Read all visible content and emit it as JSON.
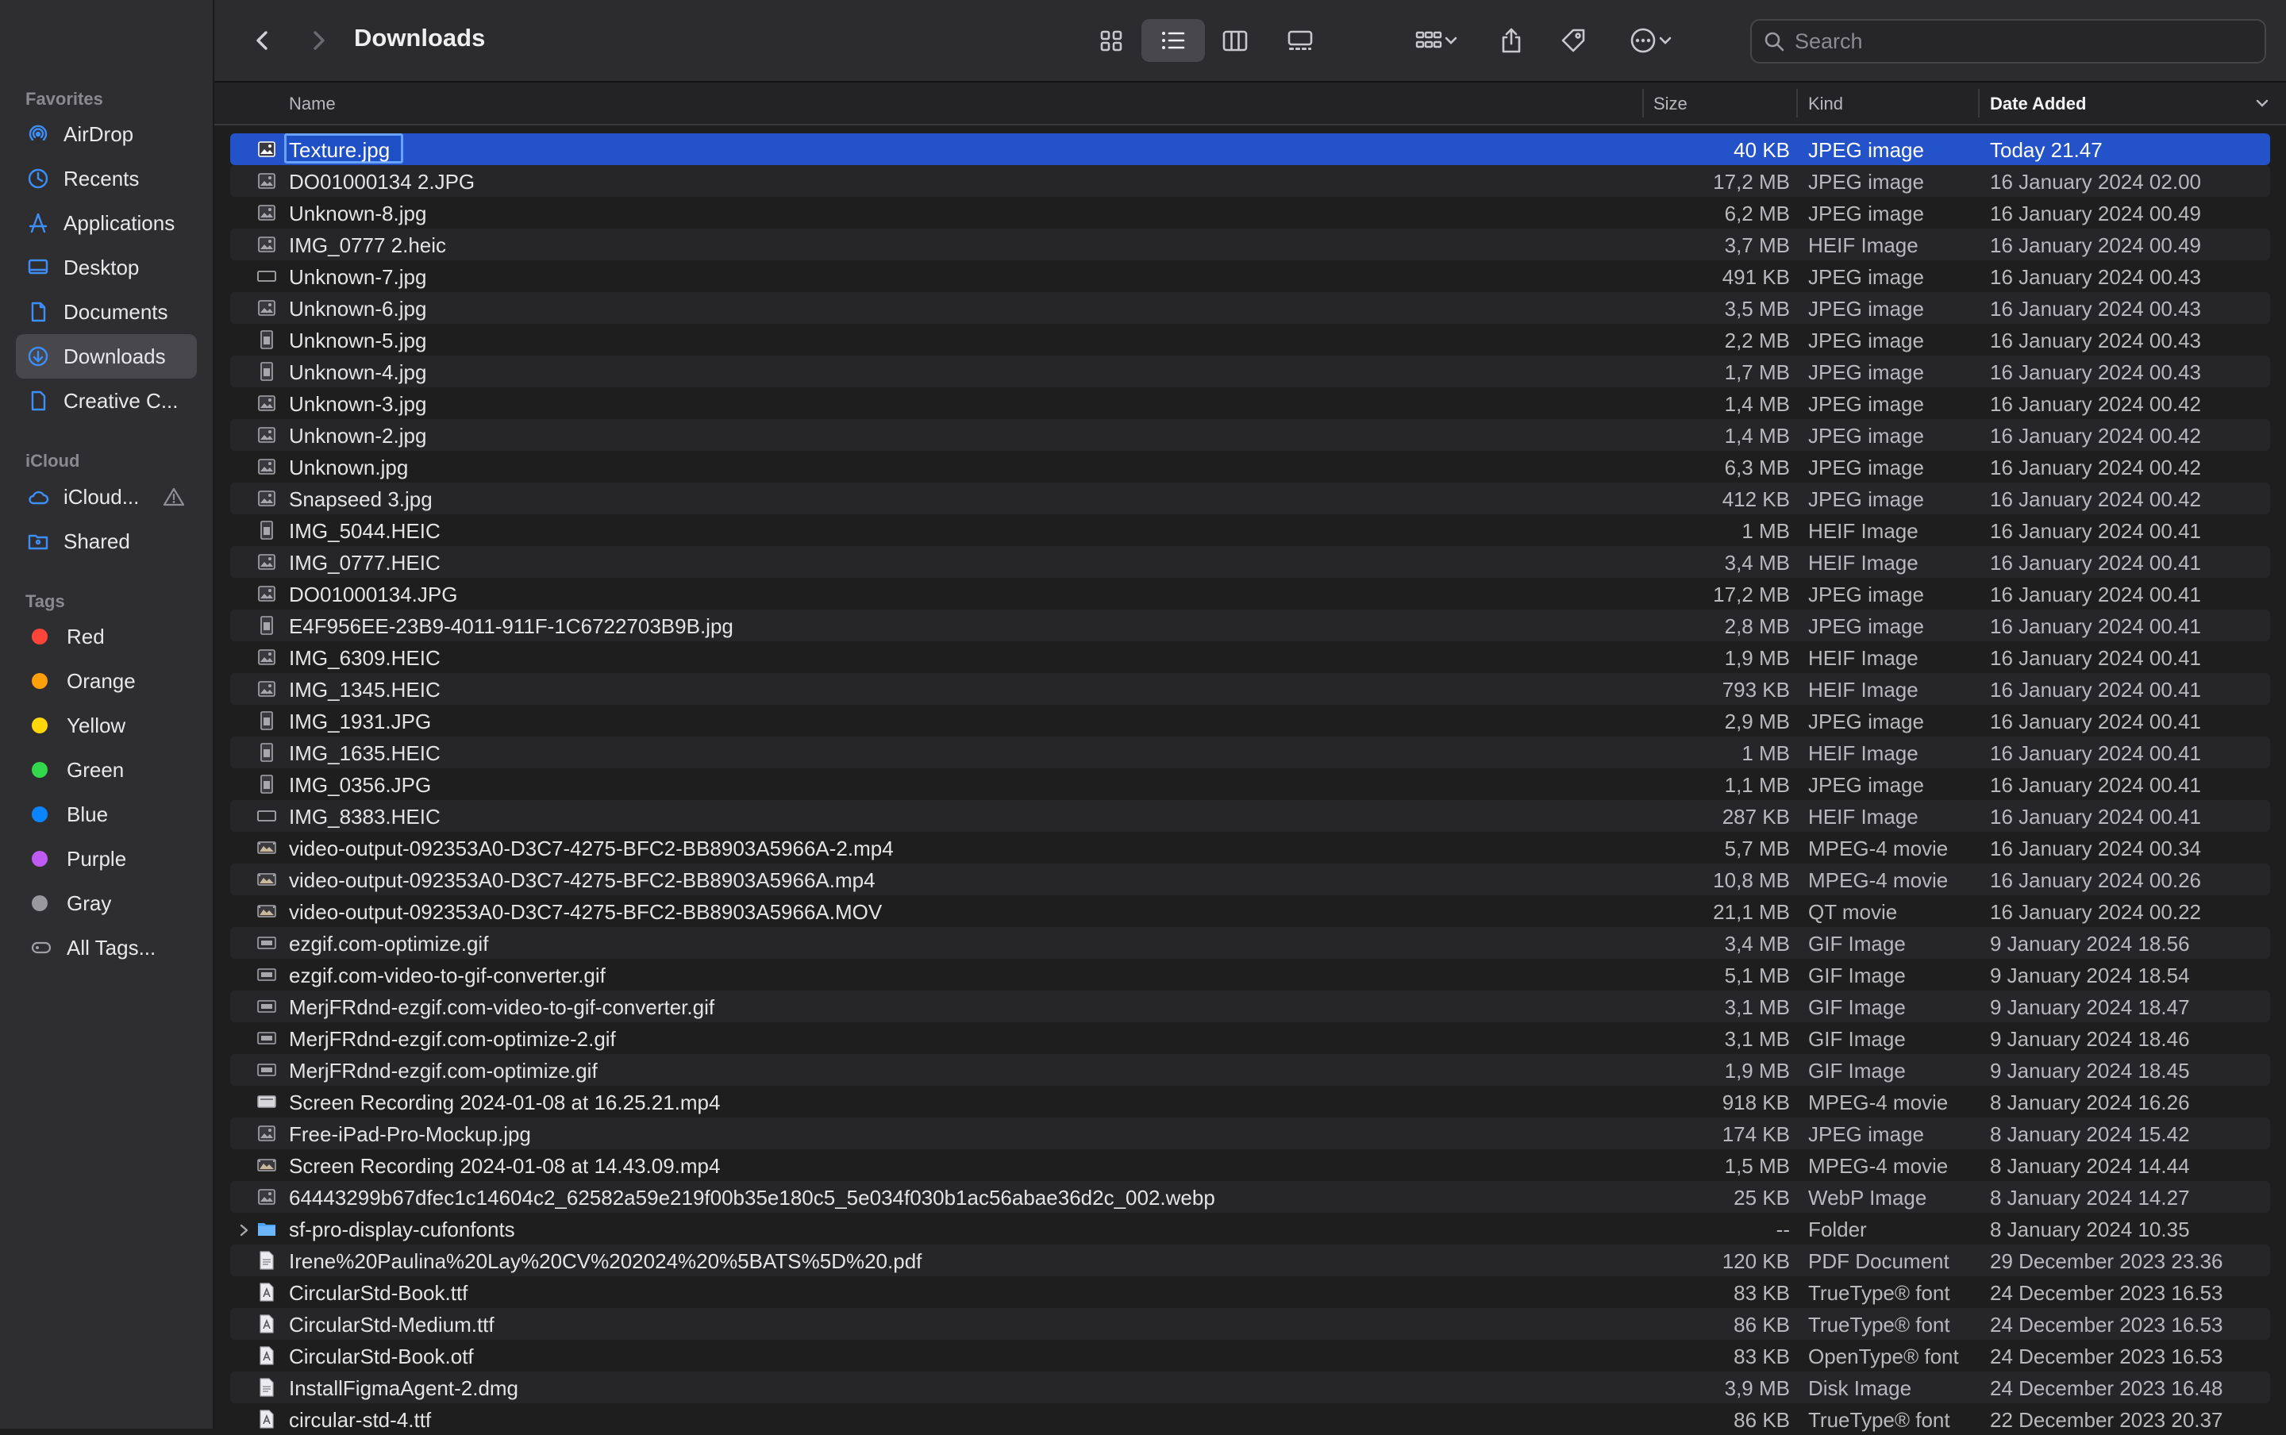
{
  "window": {
    "title": "Downloads"
  },
  "sidebar": {
    "favorites_label": "Favorites",
    "icloud_label": "iCloud",
    "tags_label": "Tags",
    "favorites": [
      {
        "label": "AirDrop",
        "icon": "airdrop-icon"
      },
      {
        "label": "Recents",
        "icon": "clock-icon"
      },
      {
        "label": "Applications",
        "icon": "applications-icon"
      },
      {
        "label": "Desktop",
        "icon": "desktop-icon"
      },
      {
        "label": "Documents",
        "icon": "document-icon"
      },
      {
        "label": "Downloads",
        "icon": "download-icon",
        "active": true
      },
      {
        "label": "Creative C...",
        "icon": "file-icon"
      }
    ],
    "icloud": [
      {
        "label": "iCloud...",
        "icon": "cloud-icon",
        "warning": true
      },
      {
        "label": "Shared",
        "icon": "shared-folder-icon"
      }
    ],
    "tags": [
      {
        "label": "Red",
        "color": "#ff453a"
      },
      {
        "label": "Orange",
        "color": "#ff9f0a"
      },
      {
        "label": "Yellow",
        "color": "#ffd60a"
      },
      {
        "label": "Green",
        "color": "#32d74b"
      },
      {
        "label": "Blue",
        "color": "#0a84ff"
      },
      {
        "label": "Purple",
        "color": "#bf5af2"
      },
      {
        "label": "Gray",
        "color": "#98989d"
      },
      {
        "label": "All Tags...",
        "color": null
      }
    ]
  },
  "toolbar": {
    "view_mode": "list",
    "search_placeholder": "Search"
  },
  "columns": {
    "name": "Name",
    "size": "Size",
    "kind": "Kind",
    "date": "Date Added",
    "sorted_by": "Date Added"
  },
  "files": [
    {
      "name": "Texture.jpg",
      "size": "40 KB",
      "kind": "JPEG image",
      "date": "Today 21.47",
      "icon": "image",
      "selected": true
    },
    {
      "name": "DO01000134 2.JPG",
      "size": "17,2 MB",
      "kind": "JPEG image",
      "date": "16 January 2024 02.00",
      "icon": "image"
    },
    {
      "name": "Unknown-8.jpg",
      "size": "6,2 MB",
      "kind": "JPEG image",
      "date": "16 January 2024 00.49",
      "icon": "image"
    },
    {
      "name": "IMG_0777 2.heic",
      "size": "3,7 MB",
      "kind": "HEIF Image",
      "date": "16 January 2024 00.49",
      "icon": "image"
    },
    {
      "name": "Unknown-7.jpg",
      "size": "491 KB",
      "kind": "JPEG image",
      "date": "16 January 2024 00.43",
      "icon": "image-wide"
    },
    {
      "name": "Unknown-6.jpg",
      "size": "3,5 MB",
      "kind": "JPEG image",
      "date": "16 January 2024 00.43",
      "icon": "image"
    },
    {
      "name": "Unknown-5.jpg",
      "size": "2,2 MB",
      "kind": "JPEG image",
      "date": "16 January 2024 00.43",
      "icon": "image-tall"
    },
    {
      "name": "Unknown-4.jpg",
      "size": "1,7 MB",
      "kind": "JPEG image",
      "date": "16 January 2024 00.43",
      "icon": "image-tall"
    },
    {
      "name": "Unknown-3.jpg",
      "size": "1,4 MB",
      "kind": "JPEG image",
      "date": "16 January 2024 00.42",
      "icon": "image"
    },
    {
      "name": "Unknown-2.jpg",
      "size": "1,4 MB",
      "kind": "JPEG image",
      "date": "16 January 2024 00.42",
      "icon": "image"
    },
    {
      "name": "Unknown.jpg",
      "size": "6,3 MB",
      "kind": "JPEG image",
      "date": "16 January 2024 00.42",
      "icon": "image"
    },
    {
      "name": "Snapseed 3.jpg",
      "size": "412 KB",
      "kind": "JPEG image",
      "date": "16 January 2024 00.42",
      "icon": "image"
    },
    {
      "name": "IMG_5044.HEIC",
      "size": "1 MB",
      "kind": "HEIF Image",
      "date": "16 January 2024 00.41",
      "icon": "image-tall"
    },
    {
      "name": "IMG_0777.HEIC",
      "size": "3,4 MB",
      "kind": "HEIF Image",
      "date": "16 January 2024 00.41",
      "icon": "image"
    },
    {
      "name": "DO01000134.JPG",
      "size": "17,2 MB",
      "kind": "JPEG image",
      "date": "16 January 2024 00.41",
      "icon": "image"
    },
    {
      "name": "E4F956EE-23B9-4011-911F-1C6722703B9B.jpg",
      "size": "2,8 MB",
      "kind": "JPEG image",
      "date": "16 January 2024 00.41",
      "icon": "image-tall"
    },
    {
      "name": "IMG_6309.HEIC",
      "size": "1,9 MB",
      "kind": "HEIF Image",
      "date": "16 January 2024 00.41",
      "icon": "image"
    },
    {
      "name": "IMG_1345.HEIC",
      "size": "793 KB",
      "kind": "HEIF Image",
      "date": "16 January 2024 00.41",
      "icon": "image"
    },
    {
      "name": "IMG_1931.JPG",
      "size": "2,9 MB",
      "kind": "JPEG image",
      "date": "16 January 2024 00.41",
      "icon": "image-tall"
    },
    {
      "name": "IMG_1635.HEIC",
      "size": "1 MB",
      "kind": "HEIF Image",
      "date": "16 January 2024 00.41",
      "icon": "image-tall"
    },
    {
      "name": "IMG_0356.JPG",
      "size": "1,1 MB",
      "kind": "JPEG image",
      "date": "16 January 2024 00.41",
      "icon": "image-tall"
    },
    {
      "name": "IMG_8383.HEIC",
      "size": "287 KB",
      "kind": "HEIF Image",
      "date": "16 January 2024 00.41",
      "icon": "image-wide"
    },
    {
      "name": "video-output-092353A0-D3C7-4275-BFC2-BB8903A5966A-2.mp4",
      "size": "5,7 MB",
      "kind": "MPEG-4 movie",
      "date": "16 January 2024 00.34",
      "icon": "video"
    },
    {
      "name": "video-output-092353A0-D3C7-4275-BFC2-BB8903A5966A.mp4",
      "size": "10,8 MB",
      "kind": "MPEG-4 movie",
      "date": "16 January 2024 00.26",
      "icon": "video"
    },
    {
      "name": "video-output-092353A0-D3C7-4275-BFC2-BB8903A5966A.MOV",
      "size": "21,1 MB",
      "kind": "QT movie",
      "date": "16 January 2024 00.22",
      "icon": "video"
    },
    {
      "name": "ezgif.com-optimize.gif",
      "size": "3,4 MB",
      "kind": "GIF Image",
      "date": "9 January 2024 18.56",
      "icon": "gif"
    },
    {
      "name": "ezgif.com-video-to-gif-converter.gif",
      "size": "5,1 MB",
      "kind": "GIF Image",
      "date": "9 January 2024 18.54",
      "icon": "gif"
    },
    {
      "name": "MerjFRdnd-ezgif.com-video-to-gif-converter.gif",
      "size": "3,1 MB",
      "kind": "GIF Image",
      "date": "9 January 2024 18.47",
      "icon": "gif"
    },
    {
      "name": "MerjFRdnd-ezgif.com-optimize-2.gif",
      "size": "3,1 MB",
      "kind": "GIF Image",
      "date": "9 January 2024 18.46",
      "icon": "gif"
    },
    {
      "name": "MerjFRdnd-ezgif.com-optimize.gif",
      "size": "1,9 MB",
      "kind": "GIF Image",
      "date": "9 January 2024 18.45",
      "icon": "gif"
    },
    {
      "name": "Screen Recording 2024-01-08 at 16.25.21.mp4",
      "size": "918 KB",
      "kind": "MPEG-4 movie",
      "date": "8 January 2024 16.26",
      "icon": "video-light"
    },
    {
      "name": "Free-iPad-Pro-Mockup.jpg",
      "size": "174 KB",
      "kind": "JPEG image",
      "date": "8 January 2024 15.42",
      "icon": "image"
    },
    {
      "name": "Screen Recording 2024-01-08 at 14.43.09.mp4",
      "size": "1,5 MB",
      "kind": "MPEG-4 movie",
      "date": "8 January 2024 14.44",
      "icon": "video"
    },
    {
      "name": "64443299b67dfec1c14604c2_62582a59e219f00b35e180c5_5e034f030b1ac56abae36d2c_002.webp",
      "size": "25 KB",
      "kind": "WebP Image",
      "date": "8 January 2024 14.27",
      "icon": "image"
    },
    {
      "name": "sf-pro-display-cufonfonts",
      "size": "--",
      "kind": "Folder",
      "date": "8 January 2024 10.35",
      "icon": "folder",
      "expandable": true
    },
    {
      "name": "Irene%20Paulina%20Lay%20CV%202024%20%5BATS%5D%20.pdf",
      "size": "120 KB",
      "kind": "PDF Document",
      "date": "29 December 2023 23.36",
      "icon": "document"
    },
    {
      "name": "CircularStd-Book.ttf",
      "size": "83 KB",
      "kind": "TrueType® font",
      "date": "24 December 2023 16.53",
      "icon": "font"
    },
    {
      "name": "CircularStd-Medium.ttf",
      "size": "86 KB",
      "kind": "TrueType® font",
      "date": "24 December 2023 16.53",
      "icon": "font"
    },
    {
      "name": "CircularStd-Book.otf",
      "size": "83 KB",
      "kind": "OpenType® font",
      "date": "24 December 2023 16.53",
      "icon": "font"
    },
    {
      "name": "InstallFigmaAgent-2.dmg",
      "size": "3,9 MB",
      "kind": "Disk Image",
      "date": "24 December 2023 16.48",
      "icon": "document"
    },
    {
      "name": "circular-std-4.ttf",
      "size": "86 KB",
      "kind": "TrueType® font",
      "date": "22 December 2023 20.37",
      "icon": "font"
    }
  ]
}
